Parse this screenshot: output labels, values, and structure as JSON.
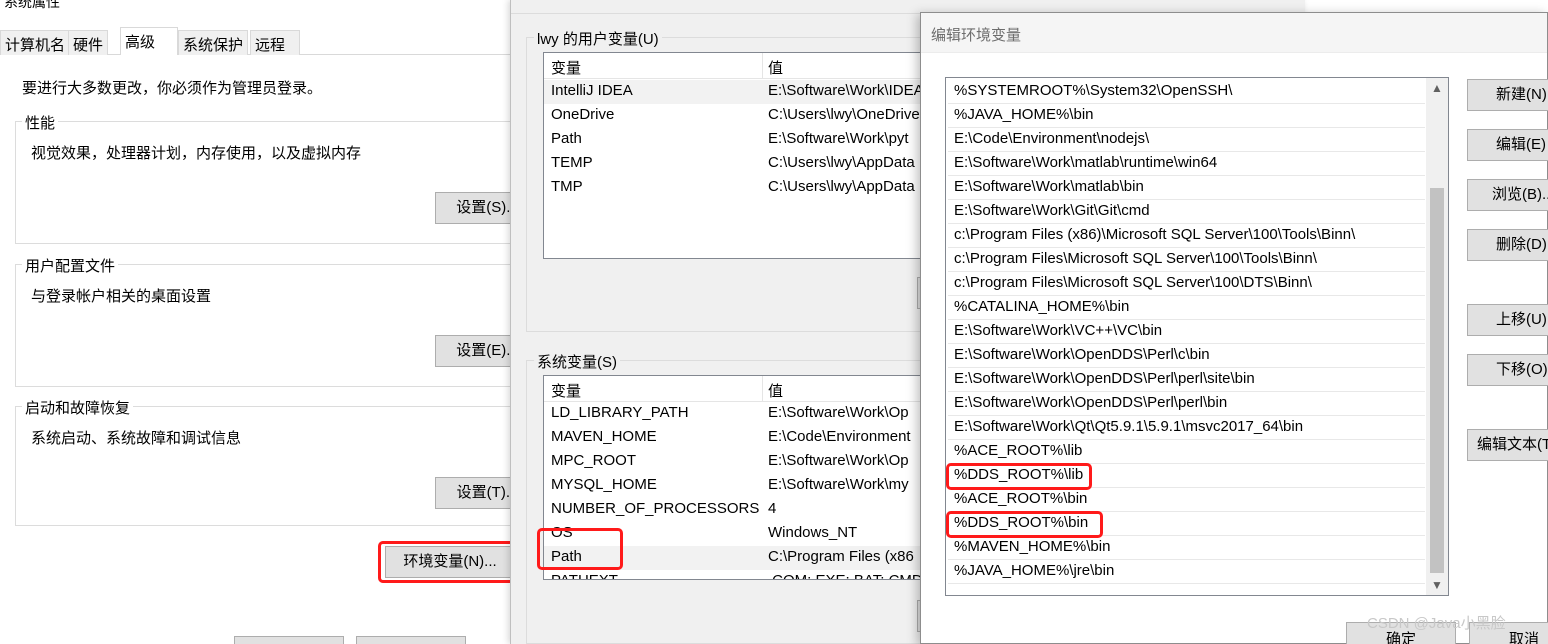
{
  "system_properties": {
    "title": "系统属性",
    "tabs": [
      "计算机名",
      "硬件",
      "高级",
      "系统保护",
      "远程"
    ],
    "active_tab": "高级",
    "admin_note": "要进行大多数更改，你必须作为管理员登录。",
    "performance": {
      "label": "性能",
      "description": "视觉效果，处理器计划，内存使用，以及虚拟内存",
      "button": "设置(S)..."
    },
    "user_profiles": {
      "label": "用户配置文件",
      "description": "与登录帐户相关的桌面设置",
      "button": "设置(E)..."
    },
    "startup_recovery": {
      "label": "启动和故障恢复",
      "description": "系统启动、系统故障和调试信息",
      "button": "设置(T)..."
    },
    "env_button": "环境变量(N)..."
  },
  "environment_variables": {
    "user_section": "lwy 的用户变量(U)",
    "system_section": "系统变量(S)",
    "col_variable": "变量",
    "col_value": "值",
    "user_vars": [
      {
        "name": "IntelliJ IDEA",
        "value": "E:\\Software\\Work\\IDEA"
      },
      {
        "name": "OneDrive",
        "value": "C:\\Users\\lwy\\OneDrive"
      },
      {
        "name": "Path",
        "value": "E:\\Software\\Work\\pyt"
      },
      {
        "name": "TEMP",
        "value": "C:\\Users\\lwy\\AppData"
      },
      {
        "name": "TMP",
        "value": "C:\\Users\\lwy\\AppData"
      }
    ],
    "system_vars": [
      {
        "name": "LD_LIBRARY_PATH",
        "value": "E:\\Software\\Work\\Op"
      },
      {
        "name": "MAVEN_HOME",
        "value": "E:\\Code\\Environment"
      },
      {
        "name": "MPC_ROOT",
        "value": "E:\\Software\\Work\\Op"
      },
      {
        "name": "MYSQL_HOME",
        "value": "E:\\Software\\Work\\my"
      },
      {
        "name": "NUMBER_OF_PROCESSORS",
        "value": "4"
      },
      {
        "name": "OS",
        "value": "Windows_NT"
      },
      {
        "name": "Path",
        "value": "C:\\Program Files (x86"
      },
      {
        "name": "PATHEXT",
        "value": ".COM;.EXE;.BAT;.CMD"
      }
    ]
  },
  "edit_env": {
    "title": "编辑环境变量",
    "paths": [
      "%SYSTEMROOT%\\System32\\OpenSSH\\",
      "%JAVA_HOME%\\bin",
      "E:\\Code\\Environment\\nodejs\\",
      "E:\\Software\\Work\\matlab\\runtime\\win64",
      "E:\\Software\\Work\\matlab\\bin",
      "E:\\Software\\Work\\Git\\Git\\cmd",
      "c:\\Program Files (x86)\\Microsoft SQL Server\\100\\Tools\\Binn\\",
      "c:\\Program Files\\Microsoft SQL Server\\100\\Tools\\Binn\\",
      "c:\\Program Files\\Microsoft SQL Server\\100\\DTS\\Binn\\",
      "%CATALINA_HOME%\\bin",
      "E:\\Software\\Work\\VC++\\VC\\bin",
      "E:\\Software\\Work\\OpenDDS\\Perl\\c\\bin",
      "E:\\Software\\Work\\OpenDDS\\Perl\\perl\\site\\bin",
      "E:\\Software\\Work\\OpenDDS\\Perl\\perl\\bin",
      "E:\\Software\\Work\\Qt\\Qt5.9.1\\5.9.1\\msvc2017_64\\bin",
      "%ACE_ROOT%\\lib",
      "%DDS_ROOT%\\lib",
      "%ACE_ROOT%\\bin",
      "%DDS_ROOT%\\bin",
      "%MAVEN_HOME%\\bin",
      "%JAVA_HOME%\\jre\\bin"
    ],
    "buttons": {
      "new": "新建(N)",
      "edit": "编辑(E)",
      "browse": "浏览(B)...",
      "delete": "删除(D)",
      "move_up": "上移(U)",
      "move_down": "下移(O)",
      "edit_text": "编辑文本(T)...",
      "ok": "确定",
      "cancel": "取消"
    }
  },
  "watermark": "CSDN @Java小黑脸",
  "highlight_color": "#ff1a1a"
}
